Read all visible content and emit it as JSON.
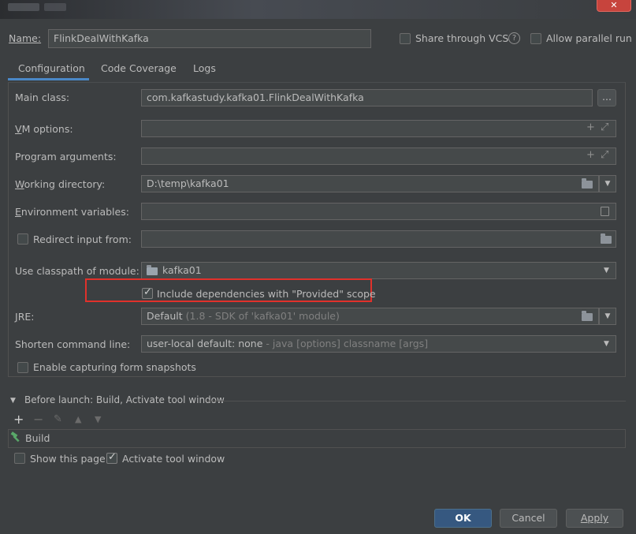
{
  "window": {
    "close_glyph": "✕"
  },
  "header": {
    "name_label": "Name:",
    "name_value": "FlinkDealWithKafka",
    "share_label": "Share through VCS",
    "help_glyph": "?",
    "parallel_label": "Allow parallel run"
  },
  "tabs": [
    {
      "label": "Configuration",
      "active": true
    },
    {
      "label": "Code Coverage",
      "active": false
    },
    {
      "label": "Logs",
      "active": false
    }
  ],
  "form": {
    "main_class_label": "Main class:",
    "main_class_value": "com.kafkastudy.kafka01.FlinkDealWithKafka",
    "browse_label": "...",
    "vm_options_label": "VM options:",
    "program_args_label": "Program arguments:",
    "working_dir_label": "Working directory:",
    "working_dir_value": "D:\\temp\\kafka01",
    "env_vars_label": "Environment variables:",
    "redirect_label": "Redirect input from:",
    "classpath_label": "Use classpath of module:",
    "classpath_value": "kafka01",
    "include_deps_label": "Include dependencies with \"Provided\" scope",
    "jre_label": "JRE:",
    "jre_value": "Default",
    "jre_hint": "(1.8 - SDK of 'kafka01' module)",
    "shorten_label": "Shorten command line:",
    "shorten_value": "user-local default: none",
    "shorten_hint": "- java [options] classname [args]",
    "capture_label": "Enable capturing form snapshots"
  },
  "before_launch": {
    "title": "Before launch: Build, Activate tool window",
    "toolbar": [
      "+",
      "−",
      "✎",
      "▲",
      "▼"
    ],
    "task": "Build",
    "show_page_label": "Show this page",
    "activate_label": "Activate tool window"
  },
  "footer": {
    "ok": "OK",
    "cancel": "Cancel",
    "apply": "Apply"
  },
  "colors": {
    "accent": "#4a88c7",
    "highlight": "#e0312b",
    "primary_button": "#365880"
  }
}
